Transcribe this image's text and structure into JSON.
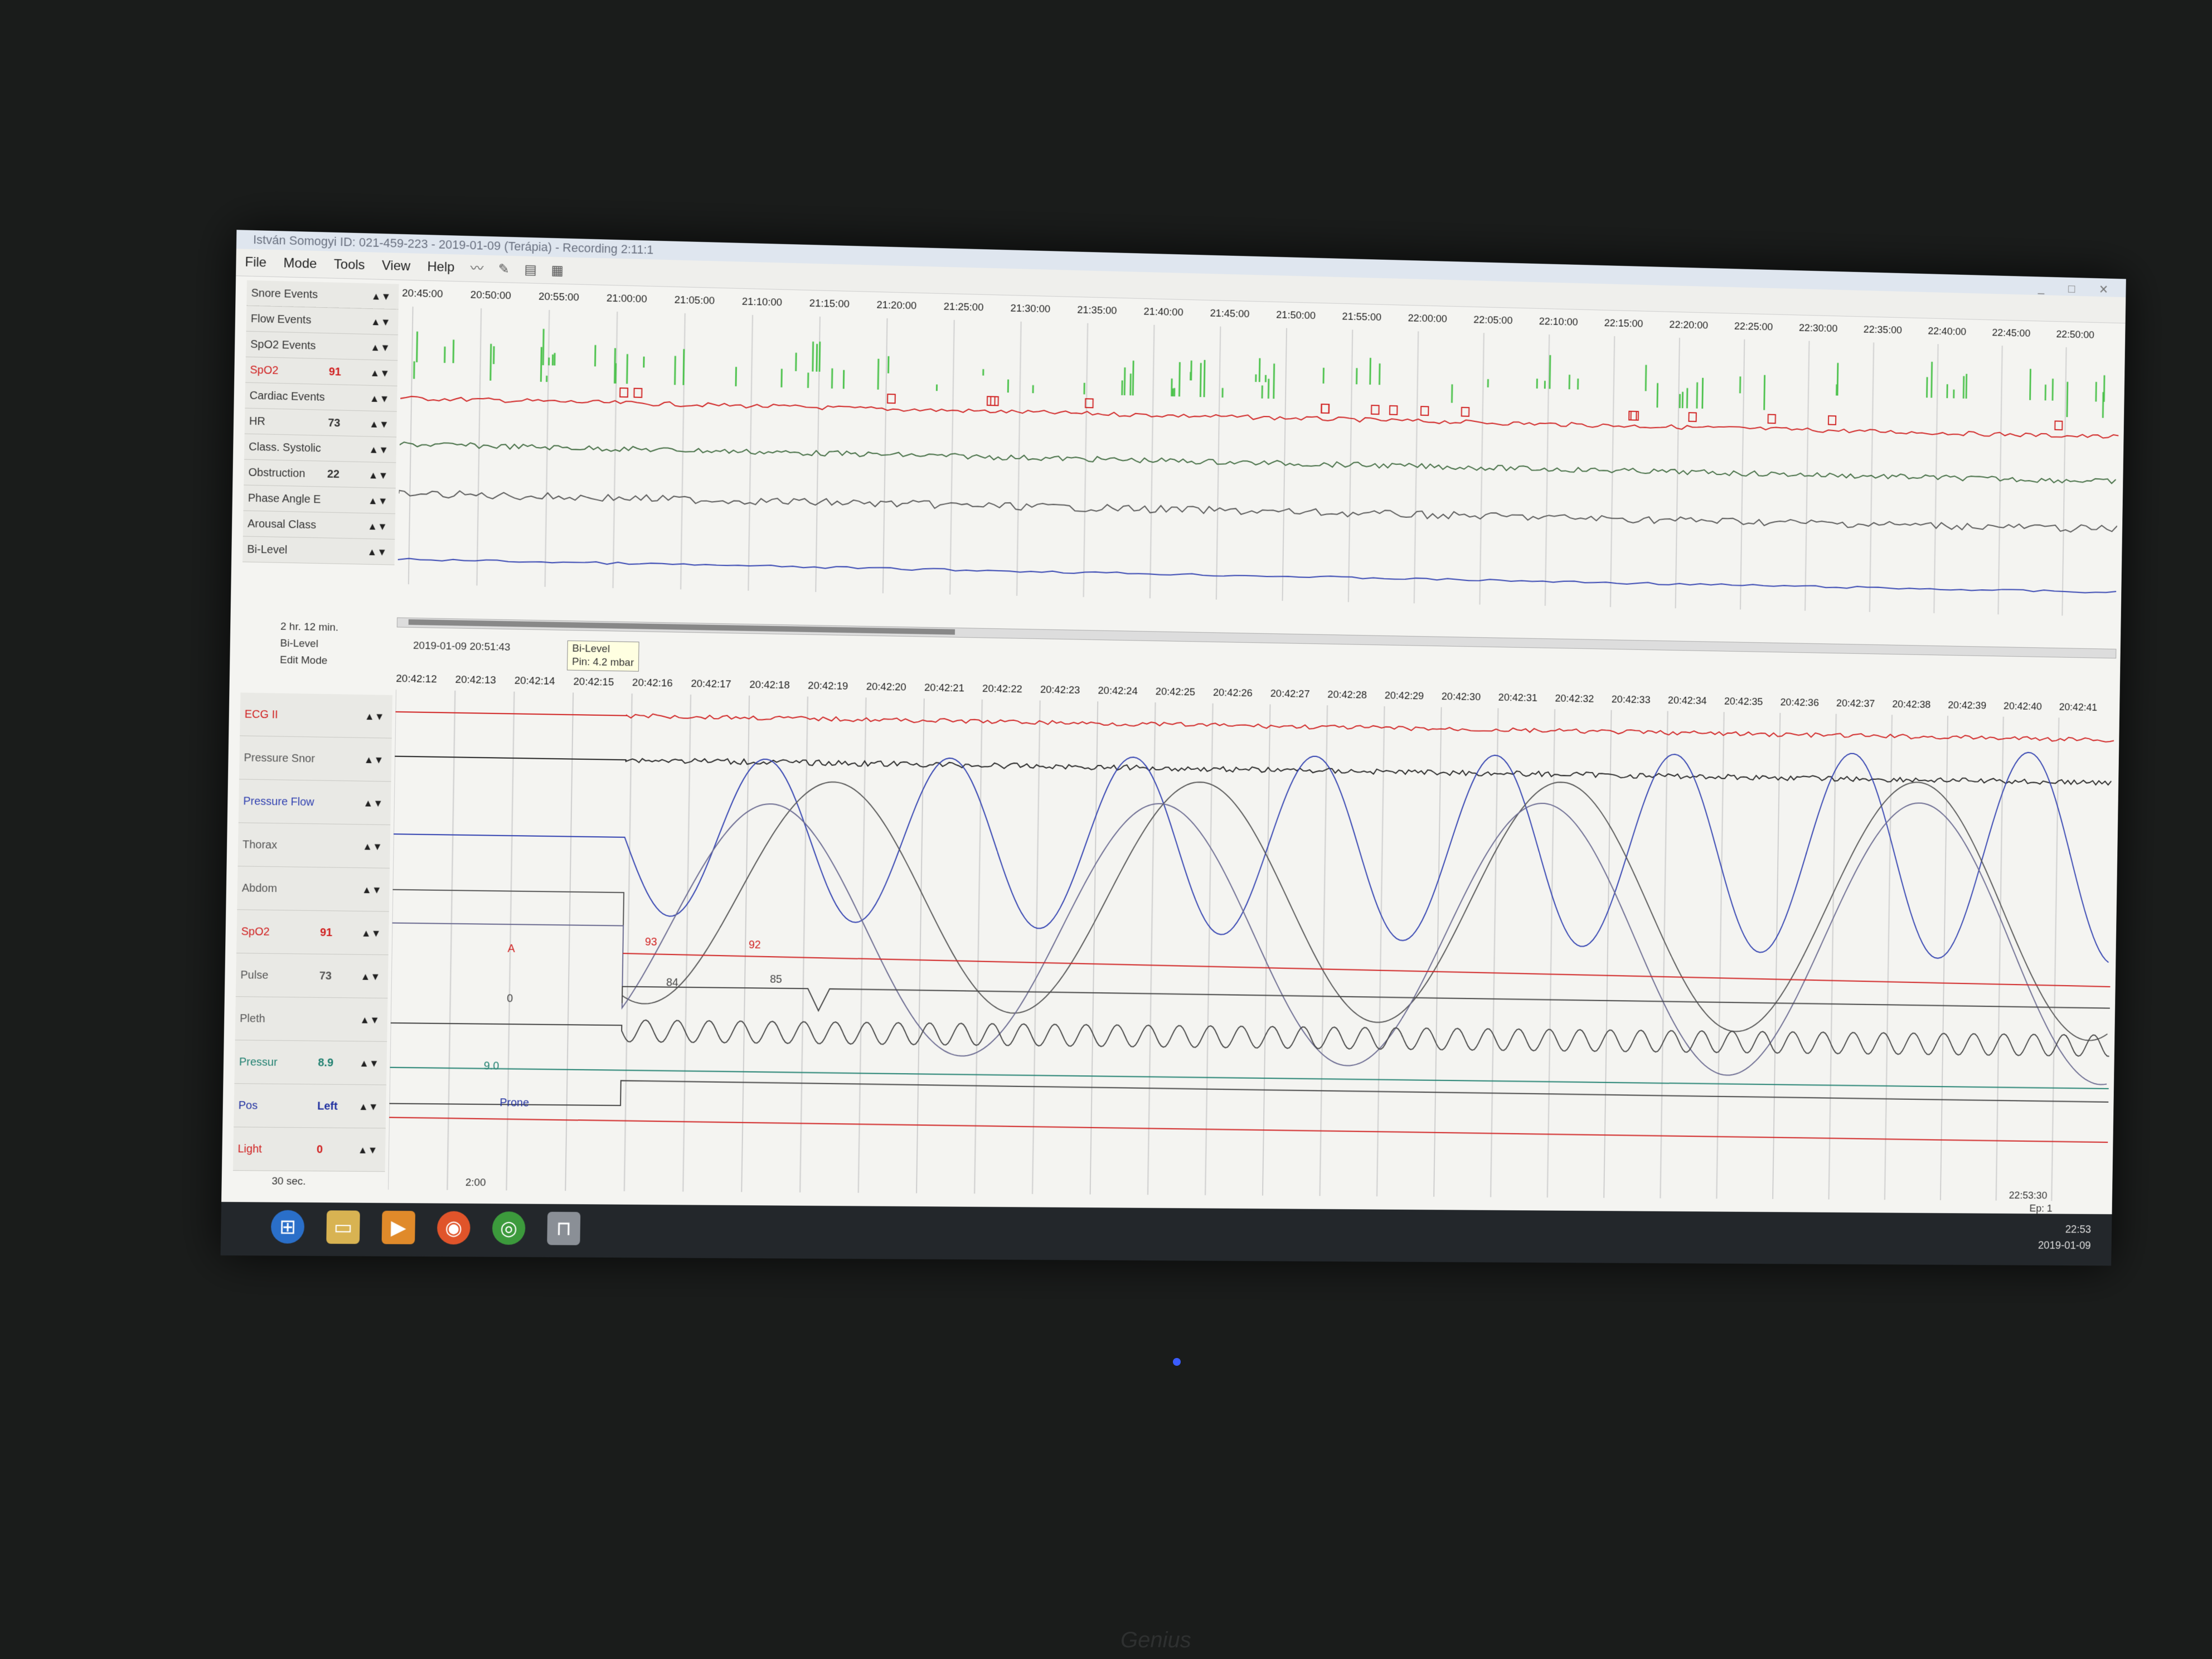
{
  "window": {
    "title": "István Somogyi ID: 021-459-223 - 2019-01-09 (Terápia) - Recording 2:11:1"
  },
  "menu": [
    "File",
    "Mode",
    "Tools",
    "View",
    "Help"
  ],
  "toolbar_icons": [
    "wave-icon",
    "tool-icon",
    "doc-icon",
    "chart-icon"
  ],
  "overview": {
    "time_labels": [
      "20:45:00",
      "20:50:00",
      "20:55:00",
      "21:00:00",
      "21:05:00",
      "21:10:00",
      "21:15:00",
      "21:20:00",
      "21:25:00",
      "21:30:00",
      "21:35:00",
      "21:40:00",
      "21:45:00",
      "21:50:00",
      "21:55:00",
      "22:00:00",
      "22:05:00",
      "22:10:00",
      "22:15:00",
      "22:20:00",
      "22:25:00",
      "22:30:00",
      "22:35:00",
      "22:40:00",
      "22:45:00",
      "22:50:00"
    ],
    "channels": [
      {
        "label": "Snore Events",
        "value": "",
        "color": "#333333"
      },
      {
        "label": "Flow Events",
        "value": "",
        "color": "#333333"
      },
      {
        "label": "SpO2 Events",
        "value": "",
        "color": "#333333"
      },
      {
        "label": "SpO2",
        "value": "91",
        "color": "#d02020"
      },
      {
        "label": "Cardiac Events",
        "value": "",
        "color": "#333333"
      },
      {
        "label": "HR",
        "value": "73",
        "color": "#333333"
      },
      {
        "label": "Class. Systolic",
        "value": "",
        "color": "#333333"
      },
      {
        "label": "Obstruction",
        "value": "22",
        "color": "#333333"
      },
      {
        "label": "Phase Angle E",
        "value": "",
        "color": "#333333"
      },
      {
        "label": "Arousal Class",
        "value": "",
        "color": "#333333"
      },
      {
        "label": "Bi-Level",
        "value": "",
        "color": "#333333"
      }
    ],
    "span": "2 hr. 12 min."
  },
  "status_row": {
    "label1": "Bi-Level",
    "label2": "Edit Mode",
    "timestamp": "2019-01-09  20:51:43",
    "tooltip_title": "Bi-Level",
    "tooltip_value": "Pin: 4.2 mbar"
  },
  "detail": {
    "time_labels": [
      "20:42:12",
      "20:42:13",
      "20:42:14",
      "20:42:15",
      "20:42:16",
      "20:42:17",
      "20:42:18",
      "20:42:19",
      "20:42:20",
      "20:42:21",
      "20:42:22",
      "20:42:23",
      "20:42:24",
      "20:42:25",
      "20:42:26",
      "20:42:27",
      "20:42:28",
      "20:42:29",
      "20:42:30",
      "20:42:31",
      "20:42:32",
      "20:42:33",
      "20:42:34",
      "20:42:35",
      "20:42:36",
      "20:42:37",
      "20:42:38",
      "20:42:39",
      "20:42:40",
      "20:42:41"
    ],
    "channels": [
      {
        "label": "ECG II",
        "value": "",
        "color": "#d02020"
      },
      {
        "label": "Pressure Snor",
        "value": "",
        "color": "#555555"
      },
      {
        "label": "Pressure Flow",
        "value": "",
        "color": "#3040b0"
      },
      {
        "label": "Thorax",
        "value": "",
        "color": "#555555"
      },
      {
        "label": "Abdom",
        "value": "",
        "color": "#555555"
      },
      {
        "label": "SpO2",
        "value": "91",
        "color": "#d02020"
      },
      {
        "label": "Pulse",
        "value": "73",
        "color": "#555555"
      },
      {
        "label": "Pleth",
        "value": "",
        "color": "#555555"
      },
      {
        "label": "Pressur",
        "value": "8.9",
        "color": "#208070"
      },
      {
        "label": "Pos",
        "value": "Left",
        "color": "#2030a0"
      },
      {
        "label": "Light",
        "value": "0",
        "color": "#d02020"
      }
    ],
    "annotations": {
      "spo2_a": "93",
      "spo2_b": "92",
      "pulse_a": "84",
      "pulse_b": "85",
      "marker_a": "A",
      "marker_0": "0",
      "pressure_val": "9.0",
      "pos_val": "Prone"
    },
    "span": "30 sec.",
    "scroll_time": "2:00"
  },
  "footer": {
    "clock": "22:53:30",
    "epoch": "Ep: 1"
  },
  "taskbar": {
    "icons": [
      "start-icon",
      "folder-icon",
      "media-icon",
      "firefox-icon",
      "chrome-icon",
      "app-icon"
    ],
    "time": "22:53",
    "date": "2019-01-09"
  },
  "colors": {
    "spo2": "#d02020",
    "hr": "#3f6a3f",
    "flow": "#3040b0",
    "events_green": "#4cc24c"
  }
}
